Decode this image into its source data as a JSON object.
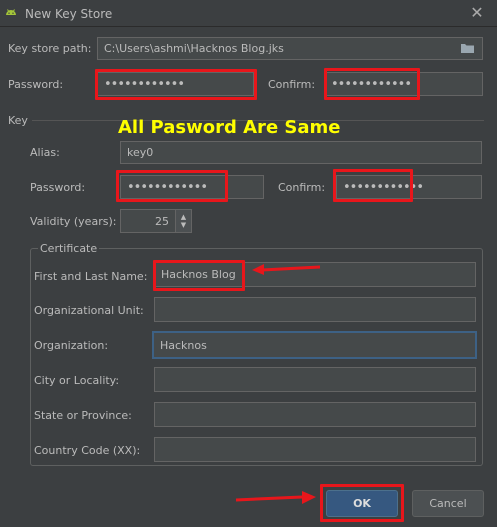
{
  "window": {
    "title": "New Key Store"
  },
  "keystore": {
    "path_label": "Key store path:",
    "path_value": "C:\\Users\\ashmi\\Hacknos Blog.jks",
    "password_label": "Password:",
    "password_value": "••••••••••••",
    "confirm_label": "Confirm:",
    "confirm_value": "••••••••••••"
  },
  "key": {
    "section_label": "Key",
    "alias_label": "Alias:",
    "alias_value": "key0",
    "password_label": "Password:",
    "password_value": "••••••••••••",
    "confirm_label": "Confirm:",
    "confirm_value": "••••••••••••",
    "validity_label": "Validity (years):",
    "validity_value": "25"
  },
  "certificate": {
    "section_label": "Certificate",
    "first_last_label": "First and Last Name:",
    "first_last_value": "Hacknos Blog",
    "org_unit_label": "Organizational Unit:",
    "org_unit_value": "",
    "org_label": "Organization:",
    "org_value": "Hacknos",
    "city_label": "City or Locality:",
    "city_value": "",
    "state_label": "State or Province:",
    "state_value": "",
    "country_label": "Country Code (XX):",
    "country_value": ""
  },
  "annotation": {
    "text": "All Pasword Are Same",
    "color": "#ffff00"
  },
  "buttons": {
    "ok": "OK",
    "cancel": "Cancel"
  },
  "colors": {
    "background": "#3c3f41",
    "field": "#45494a",
    "highlight": "#e8161b",
    "primary_button": "#365880"
  }
}
